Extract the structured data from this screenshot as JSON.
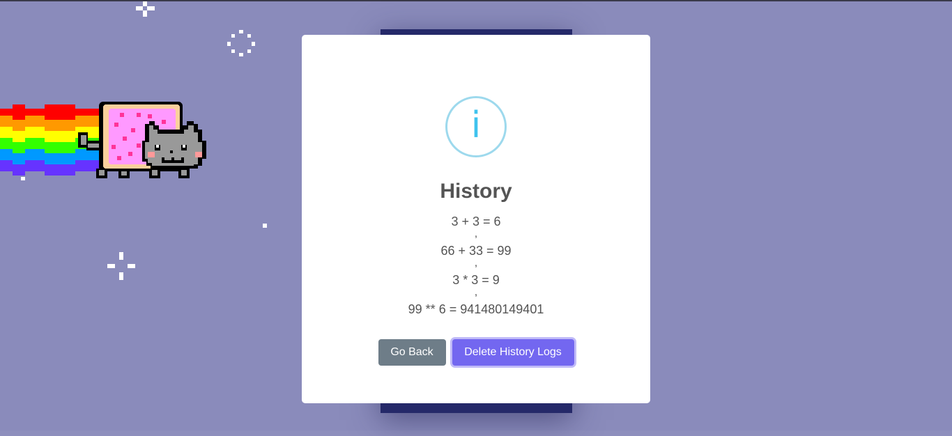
{
  "colors": {
    "background": "#8a8bbb",
    "dark_card": "#252969",
    "modal": "#ffffff",
    "info_ring": "#9dd9ed",
    "info_glyph": "#3fc3ee",
    "title_text": "#545454",
    "back_button": "#6e7d88",
    "delete_button": "#7367f0"
  },
  "modal": {
    "icon": "info-icon",
    "icon_glyph": "i",
    "title": "History",
    "entries": [
      "3 + 3 = 6",
      "66 + 33 = 99",
      "3 * 3 = 9",
      "99 ** 6 = 941480149401"
    ],
    "separator": ",",
    "buttons": {
      "back_label": "Go Back",
      "delete_label": "Delete History Logs"
    }
  },
  "background_art": {
    "character": "nyan-cat",
    "decorations": [
      "sparkle-icon",
      "sparkle-icon",
      "sparkle-icon",
      "star-dot",
      "star-dot"
    ]
  }
}
